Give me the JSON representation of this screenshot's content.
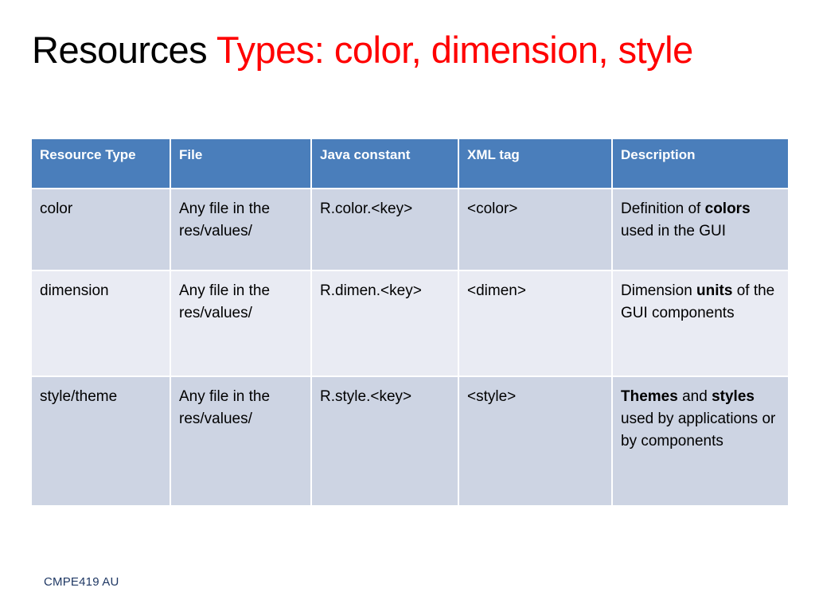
{
  "slide": {
    "title_black": "Resources ",
    "title_red": "Types: color, dimension, style",
    "footer": "CMPE419 AU"
  },
  "colors": {
    "header_background": "#4A7EBB",
    "header_text": "#FFFFFF",
    "row_shade_dark": "#CDD4E3",
    "row_shade_light": "#E9EBF3",
    "title_accent": "#FF0000",
    "title_primary": "#000000",
    "footer_text": "#1F3864",
    "page_background": "#FFFFFF"
  },
  "table": {
    "headers": [
      "Resource Type",
      "File",
      "Java constant",
      "XML tag",
      "Description"
    ],
    "rows": [
      {
        "resource_type": "color",
        "file": "Any file in the res/values/",
        "java_constant": "R.color.<key>",
        "xml_tag": "<color>",
        "description_part1": "Definition of ",
        "description_bold": "colors",
        "description_part2": " used in the GUI"
      },
      {
        "resource_type": "dimension",
        "file": "Any file in the res/values/",
        "java_constant": "R.dimen.<key>",
        "xml_tag": "<dimen>",
        "description_part1": "Dimension ",
        "description_bold": "units",
        "description_part2": " of the GUI components"
      },
      {
        "resource_type": "style/theme",
        "file": "Any file in the res/values/",
        "java_constant": "R.style.<key>",
        "xml_tag": "<style>",
        "description_part1": "",
        "description_bold": "Themes",
        "description_part2": " and ",
        "description_bold2": "styles",
        "description_part3": " used by applications or by components"
      }
    ]
  }
}
